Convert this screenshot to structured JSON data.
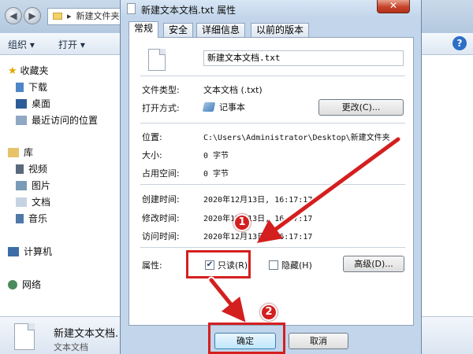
{
  "explorer": {
    "address_text": "新建文件夹",
    "toolbar": {
      "organize_label": "组织 ▾",
      "open_label": "打开 ▾"
    },
    "sidebar": {
      "favorites_label": "收藏夹",
      "downloads_label": "下载",
      "desktop_label": "桌面",
      "recent_label": "最近访问的位置",
      "library_label": "库",
      "videos_label": "视频",
      "pictures_label": "图片",
      "documents_label": "文档",
      "music_label": "音乐",
      "computer_label": "计算机",
      "network_label": "网络"
    },
    "details": {
      "file_name": "新建文本文档.",
      "file_type": "文本文档"
    }
  },
  "dialog": {
    "title": "新建文本文档.txt 属性",
    "close_label": "✕",
    "tabs": [
      "常规",
      "安全",
      "详细信息",
      "以前的版本"
    ],
    "file_name": "新建文本文档.txt",
    "file_type_label": "文件类型:",
    "file_type_value": "文本文档 (.txt)",
    "open_with_label": "打开方式:",
    "open_with_value": "记事本",
    "change_button": "更改(C)...",
    "location_label": "位置:",
    "location_value": "C:\\Users\\Administrator\\Desktop\\新建文件夹",
    "size_label": "大小:",
    "size_value": "0 字节",
    "size_on_disk_label": "占用空间:",
    "size_on_disk_value": "0 字节",
    "created_label": "创建时间:",
    "created_value": "2020年12月13日, 16:17:17",
    "modified_label": "修改时间:",
    "modified_value": "2020年12月13日, 16:17:17",
    "accessed_label": "访问时间:",
    "accessed_value": "2020年12月13日, 16:17:17",
    "attributes_label": "属性:",
    "readonly_label": "只读(R)",
    "readonly_checked": true,
    "hidden_label": "隐藏(H)",
    "hidden_checked": false,
    "advanced_button": "高级(D)...",
    "ok_button": "确定",
    "cancel_button": "取消"
  },
  "annotations": {
    "step1": "1",
    "step2": "2",
    "color": "#d41f1f"
  }
}
